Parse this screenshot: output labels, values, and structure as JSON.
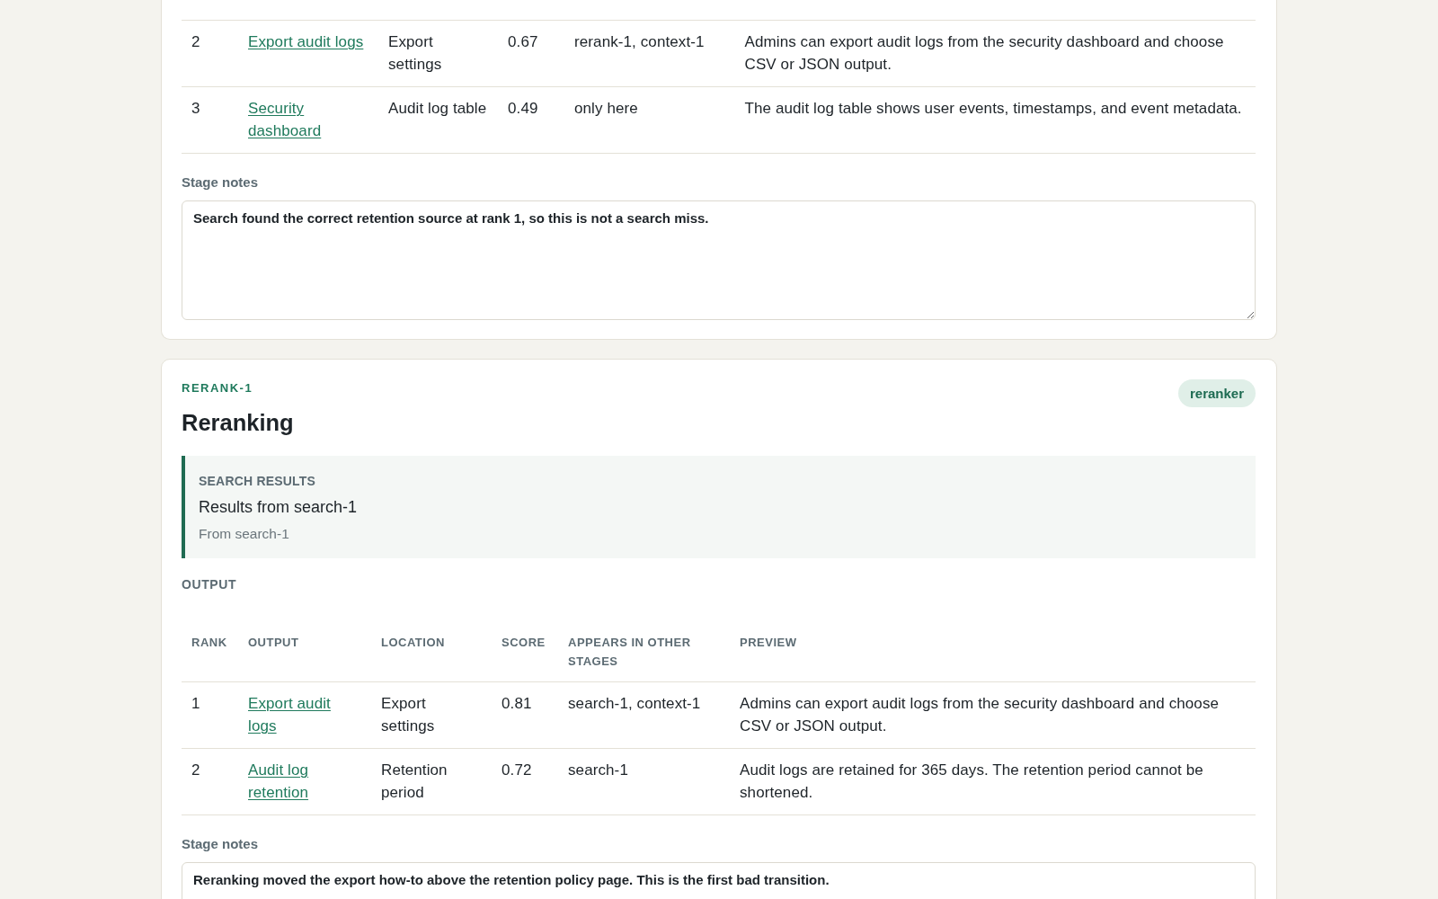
{
  "stages": [
    {
      "table": {
        "rows": [
          {
            "rank": "2",
            "output": "Export audit logs",
            "location": "Export settings",
            "score": "0.67",
            "appears_in": "rerank-1, context-1",
            "preview": "Admins can export audit logs from the security dashboard and choose CSV or JSON output."
          },
          {
            "rank": "3",
            "output": "Security dashboard",
            "location": "Audit log table",
            "score": "0.49",
            "appears_in": "only here",
            "preview": "The audit log table shows user events, timestamps, and event metadata."
          }
        ]
      },
      "notes": {
        "label": "Stage notes",
        "value": "Search found the correct retention source at rank 1, so this is not a search miss."
      }
    },
    {
      "id_label": "RERANK-1",
      "badge": "reranker",
      "title": "Reranking",
      "input": {
        "heading": "SEARCH RESULTS",
        "title": "Results from search-1",
        "source": "From search-1"
      },
      "output_label": "OUTPUT",
      "table": {
        "columns": [
          "RANK",
          "OUTPUT",
          "LOCATION",
          "SCORE",
          "APPEARS IN OTHER STAGES",
          "PREVIEW"
        ],
        "rows": [
          {
            "rank": "1",
            "output": "Export audit logs",
            "location": "Export settings",
            "score": "0.81",
            "appears_in": "search-1, context-1",
            "preview": "Admins can export audit logs from the security dashboard and choose CSV or JSON output."
          },
          {
            "rank": "2",
            "output": "Audit log retention",
            "location": "Retention period",
            "score": "0.72",
            "appears_in": "search-1",
            "preview": "Audit logs are retained for 365 days. The retention period cannot be shortened."
          }
        ]
      },
      "notes": {
        "label": "Stage notes",
        "value": "Reranking moved the export how-to above the retention policy page. This is the first bad transition."
      }
    }
  ]
}
